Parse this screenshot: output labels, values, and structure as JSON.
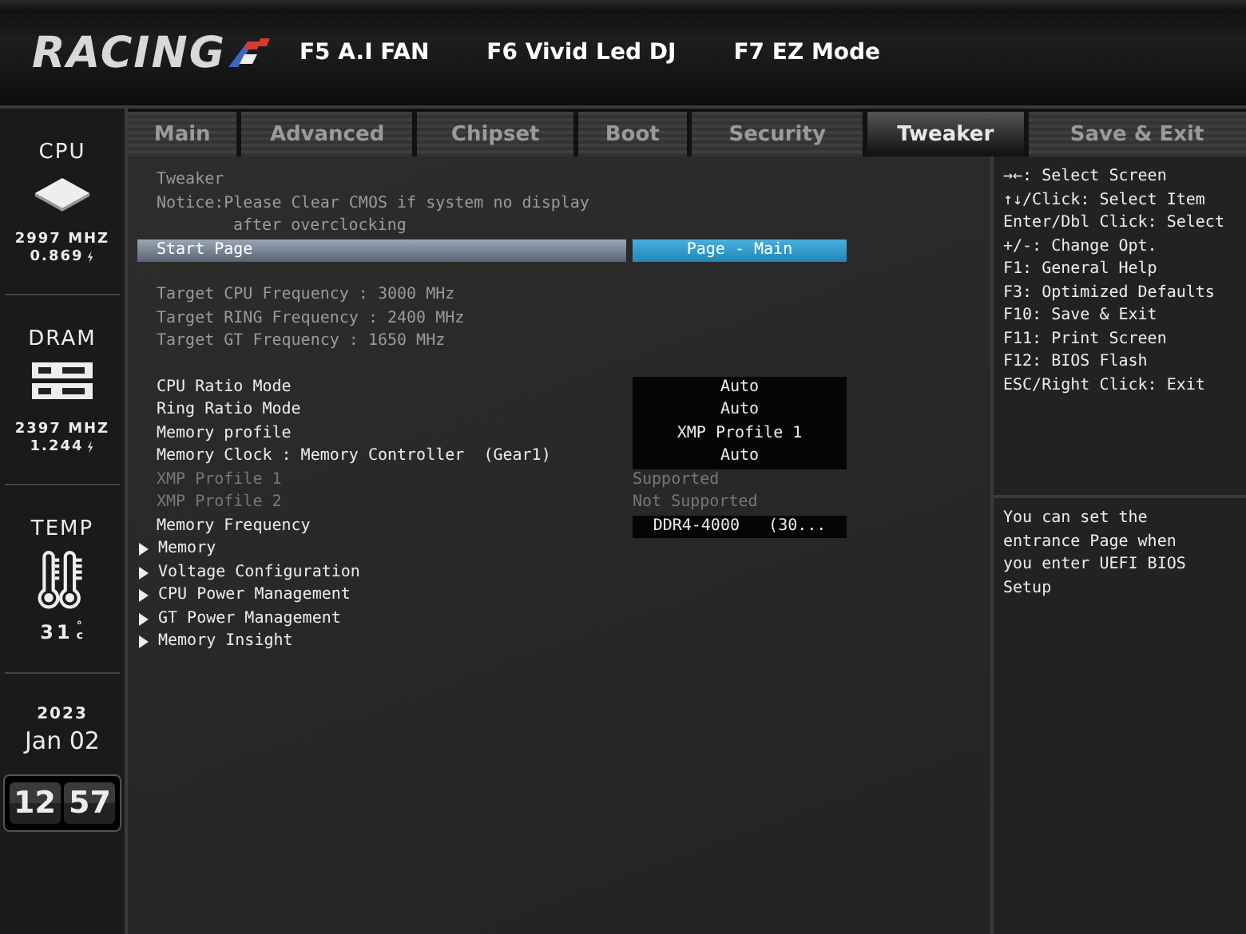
{
  "header": {
    "logo": "RACING",
    "hotkeys": [
      "F5 A.I FAN",
      "F6 Vivid Led DJ",
      "F7 EZ Mode"
    ]
  },
  "tabs": [
    {
      "label": "Main",
      "selected": false
    },
    {
      "label": "Advanced",
      "selected": false
    },
    {
      "label": "Chipset",
      "selected": false
    },
    {
      "label": "Boot",
      "selected": false
    },
    {
      "label": "Security",
      "selected": false
    },
    {
      "label": "Tweaker",
      "selected": true
    },
    {
      "label": "Save & Exit",
      "selected": false
    }
  ],
  "sidebar": {
    "cpu": {
      "label": "CPU",
      "frequency": "2997 MHZ",
      "voltage": "0.869"
    },
    "dram": {
      "label": "DRAM",
      "frequency": "2397 MHZ",
      "voltage": "1.244"
    },
    "temp": {
      "label": "TEMP",
      "value": "31",
      "unit": "°c"
    },
    "date": {
      "year": "2023",
      "day": "Jan 02"
    },
    "clock": {
      "hours": "12",
      "minutes": "57"
    }
  },
  "main": {
    "title": "Tweaker",
    "notice": [
      "Notice:Please Clear CMOS if system no display",
      "after overclocking"
    ],
    "sections": [
      [
        {
          "kind": "option",
          "label": "Start Page",
          "value": "Page - Main",
          "selected": true,
          "disabled": false
        }
      ],
      [
        {
          "kind": "info",
          "label": "Target CPU Frequency : 3000 MHz"
        },
        {
          "kind": "info",
          "label": "Target RING Frequency : 2400 MHz"
        },
        {
          "kind": "info",
          "label": "Target GT Frequency : 1650 MHz"
        }
      ],
      [
        {
          "kind": "option",
          "label": "CPU Ratio Mode",
          "value": "Auto",
          "selected": false,
          "disabled": false
        },
        {
          "kind": "option",
          "label": "Ring Ratio Mode",
          "value": "Auto",
          "selected": false,
          "disabled": false
        },
        {
          "kind": "option",
          "label": "Memory profile",
          "value": "XMP Profile 1",
          "selected": false,
          "disabled": false
        },
        {
          "kind": "option",
          "label": "Memory Clock : Memory Controller  (Gear1)",
          "value": "Auto",
          "selected": false,
          "disabled": false
        },
        {
          "kind": "option",
          "label": "XMP Profile 1",
          "value": "Supported",
          "selected": false,
          "disabled": true
        },
        {
          "kind": "option",
          "label": "XMP Profile 2",
          "value": "Not Supported",
          "selected": false,
          "disabled": true
        },
        {
          "kind": "option",
          "label": "Memory Frequency",
          "value": "DDR4-4000   (30...",
          "selected": false,
          "disabled": false
        },
        {
          "kind": "submenu",
          "label": "Memory"
        },
        {
          "kind": "submenu",
          "label": "Voltage Configuration"
        },
        {
          "kind": "submenu",
          "label": "CPU Power Management"
        },
        {
          "kind": "submenu",
          "label": "GT Power Management"
        },
        {
          "kind": "submenu",
          "label": "Memory Insight"
        }
      ]
    ]
  },
  "help": {
    "keys": [
      "→←: Select Screen",
      "↑↓/Click: Select Item",
      "Enter/Dbl Click: Select",
      "+/-: Change Opt.",
      "F1: General Help",
      "F3: Optimized Defaults",
      "F10: Save & Exit",
      "F11: Print Screen",
      "F12: BIOS Flash",
      "ESC/Right Click: Exit"
    ],
    "description": "You can set the entrance Page when you enter UEFI BIOS Setup"
  }
}
